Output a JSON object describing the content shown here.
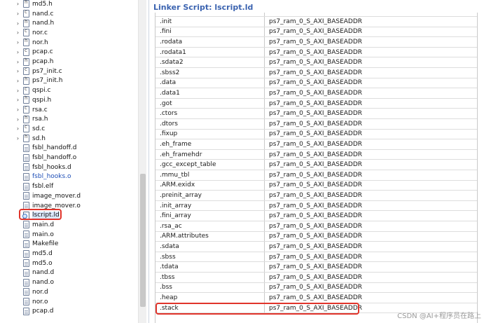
{
  "tree": {
    "items": [
      {
        "label": "md5.h",
        "type": "h",
        "expand": true
      },
      {
        "label": "nand.c",
        "type": "c",
        "expand": true
      },
      {
        "label": "nand.h",
        "type": "h",
        "expand": true
      },
      {
        "label": "nor.c",
        "type": "c",
        "expand": true
      },
      {
        "label": "nor.h",
        "type": "h",
        "expand": true
      },
      {
        "label": "pcap.c",
        "type": "c",
        "expand": true
      },
      {
        "label": "pcap.h",
        "type": "h",
        "expand": true
      },
      {
        "label": "ps7_init.c",
        "type": "c",
        "expand": true
      },
      {
        "label": "ps7_init.h",
        "type": "h",
        "expand": true
      },
      {
        "label": "qspi.c",
        "type": "c",
        "expand": true
      },
      {
        "label": "qspi.h",
        "type": "h",
        "expand": true
      },
      {
        "label": "rsa.c",
        "type": "c",
        "expand": true
      },
      {
        "label": "rsa.h",
        "type": "h",
        "expand": true
      },
      {
        "label": "sd.c",
        "type": "c",
        "expand": true
      },
      {
        "label": "sd.h",
        "type": "h",
        "expand": true
      },
      {
        "label": "fsbl_handoff.d",
        "type": "file",
        "expand": false
      },
      {
        "label": "fsbl_handoff.o",
        "type": "file",
        "expand": false
      },
      {
        "label": "fsbl_hooks.d",
        "type": "file",
        "expand": false
      },
      {
        "label": "fsbl_hooks.o",
        "type": "file",
        "expand": false,
        "link": true
      },
      {
        "label": "fsbl.elf",
        "type": "file",
        "expand": false
      },
      {
        "label": "image_mover.d",
        "type": "file",
        "expand": false
      },
      {
        "label": "image_mover.o",
        "type": "file",
        "expand": false
      },
      {
        "label": "lscript.ld",
        "type": "ld",
        "expand": false,
        "selected": true
      },
      {
        "label": "main.d",
        "type": "file",
        "expand": false
      },
      {
        "label": "main.o",
        "type": "file",
        "expand": false
      },
      {
        "label": "Makefile",
        "type": "file",
        "expand": false
      },
      {
        "label": "md5.d",
        "type": "file",
        "expand": false
      },
      {
        "label": "md5.o",
        "type": "file",
        "expand": false
      },
      {
        "label": "nand.d",
        "type": "file",
        "expand": false
      },
      {
        "label": "nand.o",
        "type": "file",
        "expand": false
      },
      {
        "label": "nor.d",
        "type": "file",
        "expand": false
      },
      {
        "label": "nor.o",
        "type": "file",
        "expand": false
      },
      {
        "label": "pcap.d",
        "type": "file",
        "expand": false
      }
    ]
  },
  "editor": {
    "title": "Linker Script: lscript.ld",
    "rows": [
      [
        ".init",
        "ps7_ram_0_S_AXI_BASEADDR"
      ],
      [
        ".fini",
        "ps7_ram_0_S_AXI_BASEADDR"
      ],
      [
        ".rodata",
        "ps7_ram_0_S_AXI_BASEADDR"
      ],
      [
        ".rodata1",
        "ps7_ram_0_S_AXI_BASEADDR"
      ],
      [
        ".sdata2",
        "ps7_ram_0_S_AXI_BASEADDR"
      ],
      [
        ".sbss2",
        "ps7_ram_0_S_AXI_BASEADDR"
      ],
      [
        ".data",
        "ps7_ram_0_S_AXI_BASEADDR"
      ],
      [
        ".data1",
        "ps7_ram_0_S_AXI_BASEADDR"
      ],
      [
        ".got",
        "ps7_ram_0_S_AXI_BASEADDR"
      ],
      [
        ".ctors",
        "ps7_ram_0_S_AXI_BASEADDR"
      ],
      [
        ".dtors",
        "ps7_ram_0_S_AXI_BASEADDR"
      ],
      [
        ".fixup",
        "ps7_ram_0_S_AXI_BASEADDR"
      ],
      [
        ".eh_frame",
        "ps7_ram_0_S_AXI_BASEADDR"
      ],
      [
        ".eh_framehdr",
        "ps7_ram_0_S_AXI_BASEADDR"
      ],
      [
        ".gcc_except_table",
        "ps7_ram_0_S_AXI_BASEADDR"
      ],
      [
        ".mmu_tbl",
        "ps7_ram_0_S_AXI_BASEADDR"
      ],
      [
        ".ARM.exidx",
        "ps7_ram_0_S_AXI_BASEADDR"
      ],
      [
        ".preinit_array",
        "ps7_ram_0_S_AXI_BASEADDR"
      ],
      [
        ".init_array",
        "ps7_ram_0_S_AXI_BASEADDR"
      ],
      [
        ".fini_array",
        "ps7_ram_0_S_AXI_BASEADDR"
      ],
      [
        ".rsa_ac",
        "ps7_ram_0_S_AXI_BASEADDR"
      ],
      [
        ".ARM.attributes",
        "ps7_ram_0_S_AXI_BASEADDR"
      ],
      [
        ".sdata",
        "ps7_ram_0_S_AXI_BASEADDR"
      ],
      [
        ".sbss",
        "ps7_ram_0_S_AXI_BASEADDR"
      ],
      [
        ".tdata",
        "ps7_ram_0_S_AXI_BASEADDR"
      ],
      [
        ".tbss",
        "ps7_ram_0_S_AXI_BASEADDR"
      ],
      [
        ".bss",
        "ps7_ram_0_S_AXI_BASEADDR"
      ],
      [
        ".heap",
        "ps7_ram_0_S_AXI_BASEADDR"
      ],
      [
        ".stack",
        "ps7_ram_0_S_AXI_BASEADDR"
      ]
    ]
  },
  "watermark": "CSDN @AI+程序员在路上",
  "colors": {
    "title": "#3b63b0",
    "highlight": "#e0342b"
  }
}
